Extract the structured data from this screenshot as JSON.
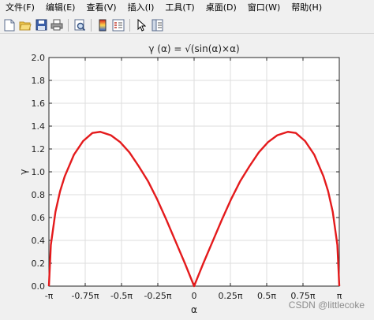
{
  "menubar": {
    "items": [
      {
        "label": "文件(F)"
      },
      {
        "label": "编辑(E)"
      },
      {
        "label": "查看(V)"
      },
      {
        "label": "插入(I)"
      },
      {
        "label": "工具(T)"
      },
      {
        "label": "桌面(D)"
      },
      {
        "label": "窗口(W)"
      },
      {
        "label": "帮助(H)"
      }
    ]
  },
  "toolbar": {
    "icons": [
      "new-file-icon",
      "open-folder-icon",
      "save-icon",
      "print-icon",
      "print-preview-icon",
      "colorbar-icon",
      "legend-icon",
      "pointer-icon",
      "property-editor-icon"
    ]
  },
  "chart_data": {
    "type": "line",
    "title": "γ (α) = √(sin(α)×α)",
    "xlabel": "α",
    "ylabel": "γ",
    "xlim": [
      -3.14159,
      3.14159
    ],
    "ylim": [
      0,
      2
    ],
    "x_ticks": [
      {
        "value": -3.14159,
        "label": "-π"
      },
      {
        "value": -2.35619,
        "label": "-0.75π"
      },
      {
        "value": -1.5708,
        "label": "-0.5π"
      },
      {
        "value": -0.7854,
        "label": "-0.25π"
      },
      {
        "value": 0,
        "label": "0"
      },
      {
        "value": 0.7854,
        "label": "0.25π"
      },
      {
        "value": 1.5708,
        "label": "0.5π"
      },
      {
        "value": 2.35619,
        "label": "0.75π"
      },
      {
        "value": 3.14159,
        "label": "π"
      }
    ],
    "y_ticks": [
      {
        "value": 0,
        "label": "0.0"
      },
      {
        "value": 0.2,
        "label": "0.2"
      },
      {
        "value": 0.4,
        "label": "0.4"
      },
      {
        "value": 0.6,
        "label": "0.6"
      },
      {
        "value": 0.8,
        "label": "0.8"
      },
      {
        "value": 1.0,
        "label": "1.0"
      },
      {
        "value": 1.2,
        "label": "1.2"
      },
      {
        "value": 1.4,
        "label": "1.4"
      },
      {
        "value": 1.6,
        "label": "1.6"
      },
      {
        "value": 1.8,
        "label": "1.8"
      },
      {
        "value": 2.0,
        "label": "2.0"
      }
    ],
    "grid": true,
    "series": [
      {
        "color": "#e41a1c",
        "x": [
          -3.14159,
          -3.1,
          -3.0,
          -2.9,
          -2.8,
          -2.6,
          -2.4,
          -2.2,
          -2.029,
          -1.8,
          -1.6,
          -1.4,
          -1.2,
          -1.0,
          -0.8,
          -0.6,
          -0.4,
          -0.2,
          0,
          0.2,
          0.4,
          0.6,
          0.8,
          1.0,
          1.2,
          1.4,
          1.6,
          1.8,
          2.029,
          2.2,
          2.4,
          2.6,
          2.8,
          2.9,
          3.0,
          3.1,
          3.14159
        ],
        "y": [
          0.0,
          0.36,
          0.65,
          0.83,
          0.96,
          1.15,
          1.27,
          1.34,
          1.35,
          1.32,
          1.26,
          1.17,
          1.05,
          0.92,
          0.76,
          0.58,
          0.39,
          0.2,
          0.0,
          0.2,
          0.39,
          0.58,
          0.76,
          0.92,
          1.05,
          1.17,
          1.26,
          1.32,
          1.35,
          1.34,
          1.27,
          1.15,
          0.96,
          0.83,
          0.65,
          0.36,
          0.0
        ]
      }
    ]
  },
  "colors": {
    "line": "#e41a1c",
    "grid": "#dedede",
    "axes": "#262626"
  },
  "watermark": "CSDN @littlecoke"
}
